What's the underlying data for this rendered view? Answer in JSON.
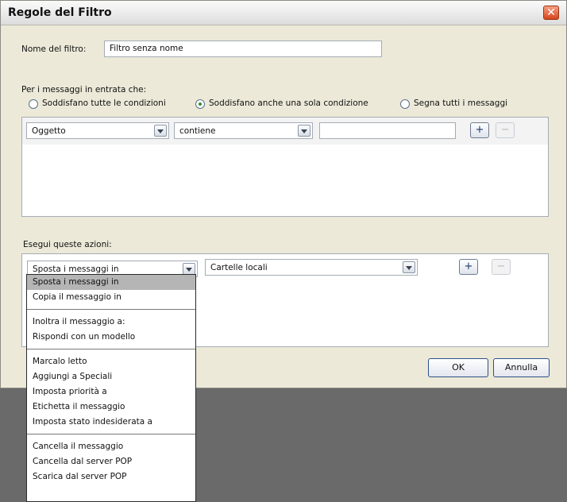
{
  "window": {
    "title": "Regole del Filtro",
    "close_icon": "close-icon"
  },
  "filter_name": {
    "label": "Nome del filtro:",
    "value": "Filtro senza nome"
  },
  "incoming": {
    "label": "Per i messaggi in entrata che:",
    "options": [
      {
        "label": "Soddisfano tutte le condizioni",
        "selected": false
      },
      {
        "label": "Soddisfano anche una sola condizione",
        "selected": true
      },
      {
        "label": "Segna tutti i messaggi",
        "selected": false
      }
    ]
  },
  "condition": {
    "field": "Oggetto",
    "operator": "contiene",
    "value": "",
    "add_label": "+",
    "remove_label": "−"
  },
  "actions": {
    "label": "Esegui queste azioni:",
    "action": "Sposta i messaggi in",
    "target": "Cartelle locali",
    "add_label": "+",
    "remove_label": "−"
  },
  "buttons": {
    "ok": "OK",
    "cancel": "Annulla"
  },
  "dropdown": {
    "groups": [
      [
        "Sposta i messaggi in",
        "Copia il messaggio in"
      ],
      [
        "Inoltra il messaggio a:",
        "Rispondi con un  modello"
      ],
      [
        "Marcalo letto",
        "Aggiungi a Speciali",
        "Imposta priorità a",
        "Etichetta il messaggio",
        "Imposta stato indesiderata a"
      ],
      [
        "Cancella il messaggio",
        "Cancella dal server POP",
        "Scarica dal server POP"
      ]
    ],
    "selected": "Sposta i messaggi in"
  },
  "colors": {
    "title_bar": "#e6e6e6",
    "dialog_bg": "#ece9d8",
    "close_button": "#e05a2b",
    "backdrop": "#6a6a6a",
    "selected_item": "#b5b5b5"
  }
}
